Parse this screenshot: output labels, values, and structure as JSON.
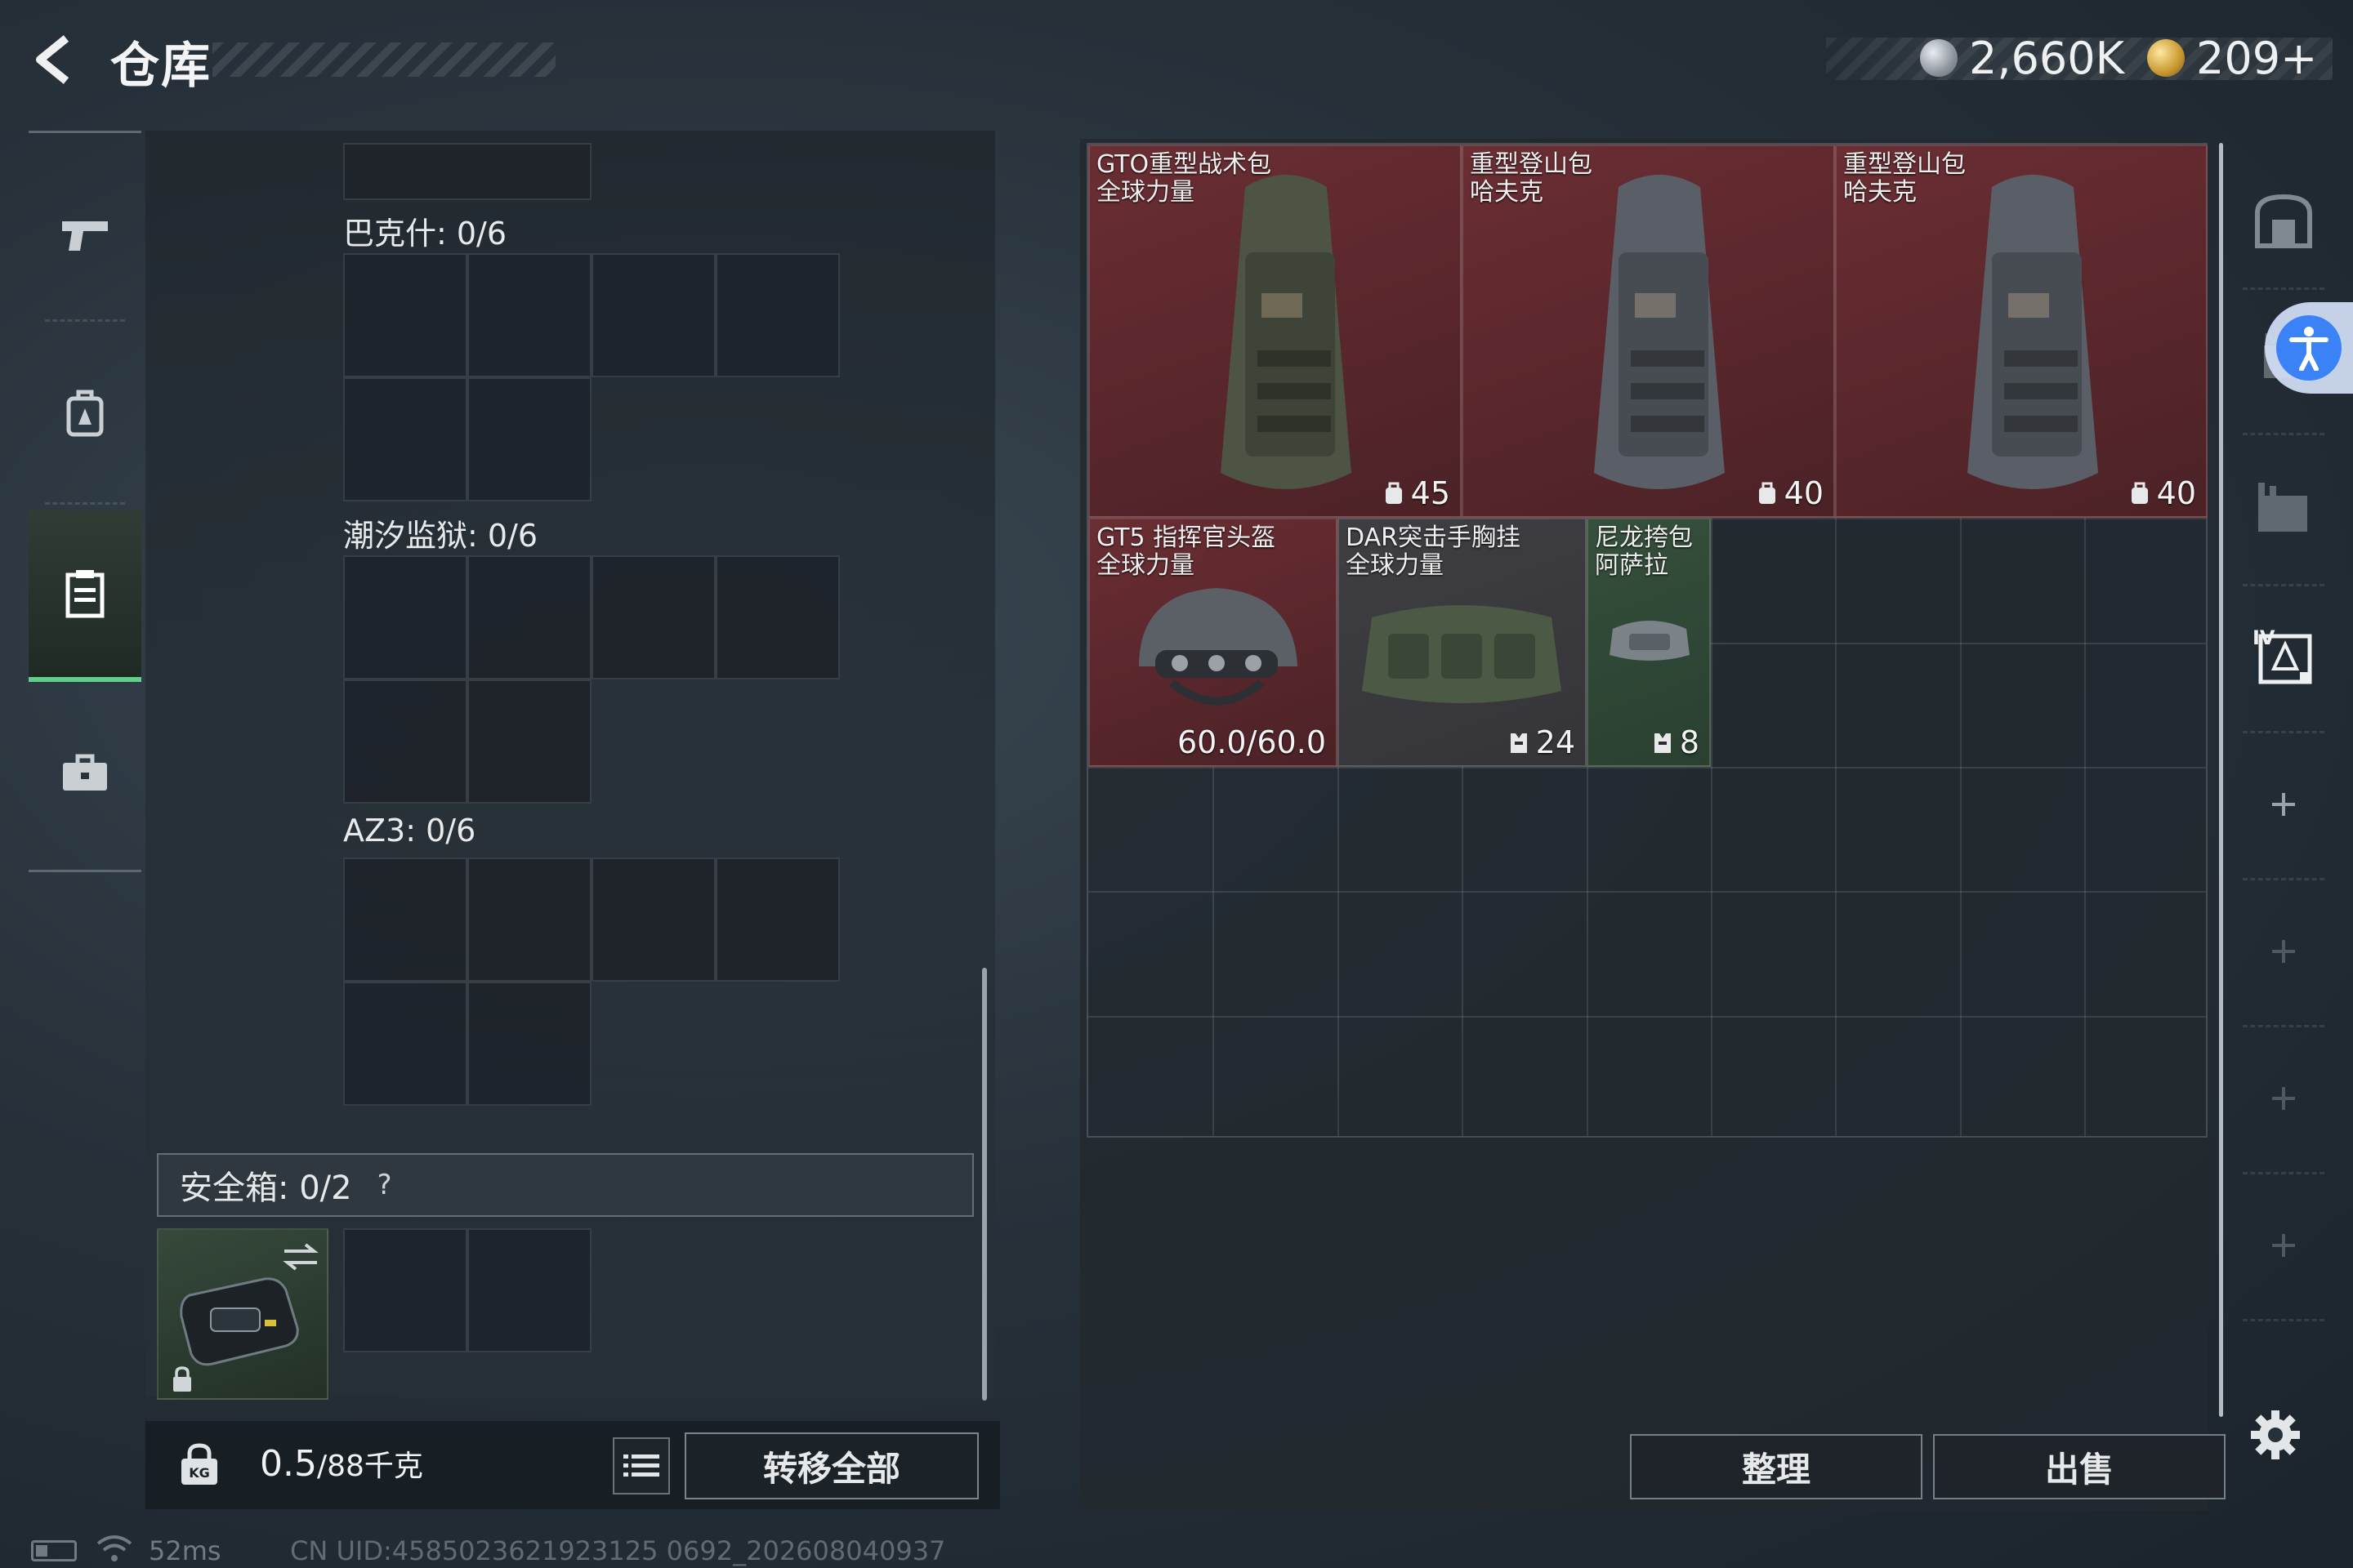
{
  "header": {
    "title": "仓库",
    "currency_silver": "2,660K",
    "currency_gold": "209+"
  },
  "left_nav": {
    "items": [
      {
        "icon": "pistol-icon"
      },
      {
        "icon": "backpack-icon"
      },
      {
        "icon": "storage-icon",
        "active": true
      },
      {
        "icon": "briefcase-icon"
      }
    ]
  },
  "containers": [
    {
      "label": "巴克什: 0/6"
    },
    {
      "label": "潮汐监狱: 0/6"
    },
    {
      "label": "AZ3: 0/6"
    }
  ],
  "safe_box": {
    "label": "安全箱: 0/2",
    "help": "?"
  },
  "bottom_bar": {
    "weight_value": "0.5",
    "weight_capacity": "/88千克",
    "transfer_all": "转移全部"
  },
  "warehouse": {
    "items": [
      {
        "name_line1": "GTO重型战术包",
        "name_line2": "全球力量",
        "value": "45",
        "value_icon": "backpack-capacity-icon",
        "rarity_color": "#6a2e33"
      },
      {
        "name_line1": "重型登山包",
        "name_line2": "哈夫克",
        "value": "40",
        "value_icon": "backpack-capacity-icon",
        "rarity_color": "#6a2e33"
      },
      {
        "name_line1": "重型登山包",
        "name_line2": "哈夫克",
        "value": "40",
        "value_icon": "backpack-capacity-icon",
        "rarity_color": "#6a2e33"
      },
      {
        "name_line1": "GT5 指挥官头盔",
        "name_line2": "全球力量",
        "value": "60.0/60.0",
        "rarity_color": "#6a2e33"
      },
      {
        "name_line1": "DAR突击手胸挂",
        "name_line2": "全球力量",
        "value": "24",
        "value_icon": "vest-capacity-icon",
        "rarity_color": "#3f3e42"
      },
      {
        "name_line1": "尼龙挎包",
        "name_line2": "阿萨拉",
        "value": "8",
        "value_icon": "vest-capacity-icon",
        "rarity_color": "#35503c"
      }
    ],
    "sort_label": "整理",
    "sell_label": "出售"
  },
  "status": {
    "ping": "52ms",
    "uid": "CN UID:4585023621923125 0692_202608040937"
  }
}
